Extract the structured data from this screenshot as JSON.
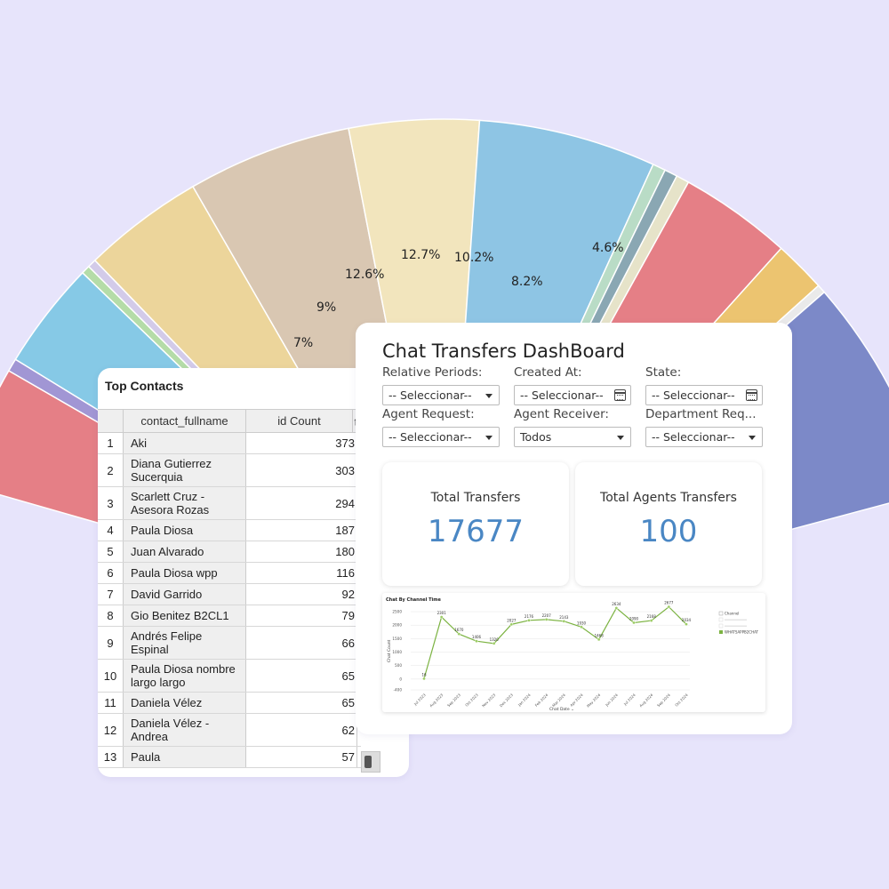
{
  "pie": {
    "labels": [
      "12.6%",
      "12.7%",
      "10.2%",
      "9%",
      "7%",
      "8.2%",
      "4.6%"
    ]
  },
  "contacts": {
    "title": "Top Contacts",
    "col_name": "contact_fullname",
    "col_count": "id Count",
    "rows": [
      {
        "n": "1",
        "name": "Aki",
        "count": "373"
      },
      {
        "n": "2",
        "name": "Diana Gutierrez Sucerquia",
        "count": "303"
      },
      {
        "n": "3",
        "name": "Scarlett Cruz - Asesora Rozas",
        "count": "294"
      },
      {
        "n": "4",
        "name": "Paula Diosa",
        "count": "187"
      },
      {
        "n": "5",
        "name": "Juan Alvarado",
        "count": "180"
      },
      {
        "n": "6",
        "name": "Paula Diosa wpp",
        "count": "116"
      },
      {
        "n": "7",
        "name": "David Garrido",
        "count": "92"
      },
      {
        "n": "8",
        "name": "Gio Benitez B2CL1",
        "count": "79"
      },
      {
        "n": "9",
        "name": "Andrés Felipe Espinal",
        "count": "66"
      },
      {
        "n": "10",
        "name": "Paula Diosa nombre largo largo",
        "count": "65"
      },
      {
        "n": "11",
        "name": "Daniela Vélez",
        "count": "65"
      },
      {
        "n": "12",
        "name": "Daniela Vélez - Andrea",
        "count": "62"
      },
      {
        "n": "13",
        "name": "Paula",
        "count": "57"
      }
    ]
  },
  "dashboard": {
    "title": "Chat Transfers DashBoard",
    "filters": [
      {
        "label": "Relative Periods:",
        "value": "-- Seleccionar--",
        "kind": "select"
      },
      {
        "label": "Created At:",
        "value": "-- Seleccionar--",
        "kind": "date"
      },
      {
        "label": "State:",
        "value": "-- Seleccionar--",
        "kind": "date"
      },
      {
        "label": "Agent Request:",
        "value": "-- Seleccionar--",
        "kind": "select"
      },
      {
        "label": "Agent Receiver:",
        "value": "Todos",
        "kind": "select"
      },
      {
        "label": "Department Req...",
        "value": "-- Seleccionar--",
        "kind": "select"
      }
    ],
    "kpis": [
      {
        "label": "Total Transfers",
        "value": "17677"
      },
      {
        "label": "Total Agents Transfers",
        "value": "100"
      }
    ],
    "accent": "#4a87c4"
  },
  "chart_data": {
    "type": "line",
    "title": "Chat By Channel Time",
    "xlabel": "Chat Date",
    "ylabel": "Chat Count",
    "ylim": [
      -400,
      2500
    ],
    "yticks": [
      2500,
      2000,
      1500,
      1000,
      500,
      0,
      -400
    ],
    "x": [
      "Jul 2023",
      "Aug 2023",
      "Sep 2023",
      "Oct 2023",
      "Nov 2023",
      "Dec 2023",
      "Jan 2024",
      "Feb 2024",
      "Mar 2024",
      "Apr 2024",
      "May 2024",
      "Jun 2024",
      "Jul 2024",
      "Aug 2024",
      "Sep 2024",
      "Oct 2024"
    ],
    "series": [
      {
        "name": "WHATSAPPB2CHAT",
        "color": "#7cb342",
        "values": [
          16,
          2301,
          1670,
          1406,
          1320,
          2027,
          2176,
          2207,
          2143,
          1930,
          1468,
          2634,
          2090,
          2168,
          2677,
          2034
        ],
        "labels": [
          "16",
          "2301",
          "1670",
          "1406",
          "1320",
          "2027",
          "2176",
          "2207",
          "2143",
          "1930",
          "1468",
          "2634",
          "2090",
          "2168",
          "2677",
          "2034"
        ]
      }
    ],
    "legend": {
      "title": "Channel",
      "position": "right"
    },
    "grid": true
  }
}
